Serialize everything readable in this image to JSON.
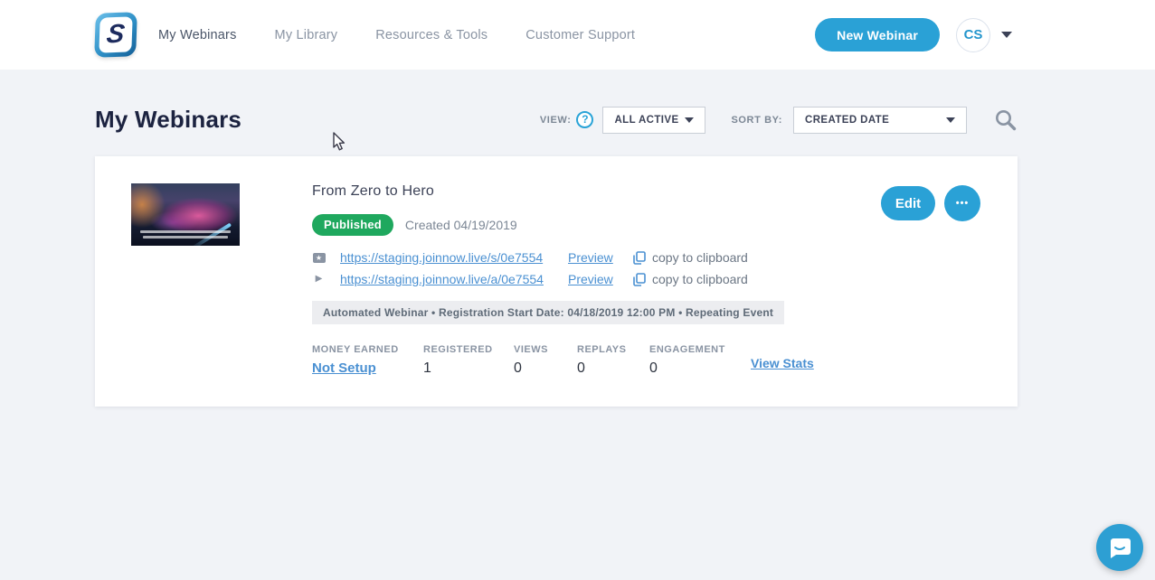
{
  "header": {
    "logo_text": "S",
    "nav": [
      {
        "label": "My Webinars"
      },
      {
        "label": "My Library"
      },
      {
        "label": "Resources & Tools"
      },
      {
        "label": "Customer Support"
      }
    ],
    "new_webinar_label": "New Webinar",
    "avatar_initials": "CS"
  },
  "toolbar": {
    "page_title": "My Webinars",
    "view_label": "VIEW:",
    "view_value": "ALL ACTIVE",
    "sort_label": "SORT BY:",
    "sort_value": "CREATED DATE"
  },
  "webinar": {
    "title": "From Zero to Hero",
    "status_badge": "Published",
    "created": "Created 04/19/2019",
    "links": [
      {
        "url": "https://staging.joinnow.live/s/0e7554",
        "preview_label": "Preview",
        "copy_label": "copy to clipboard"
      },
      {
        "url": "https://staging.joinnow.live/a/0e7554",
        "preview_label": "Preview",
        "copy_label": "copy to clipboard"
      }
    ],
    "info_bar": "Automated Webinar • Registration Start Date: 04/18/2019 12:00 PM • Repeating Event",
    "stats": [
      {
        "label": "MONEY EARNED",
        "value": "Not Setup"
      },
      {
        "label": "REGISTERED",
        "value": "1"
      },
      {
        "label": "VIEWS",
        "value": "0"
      },
      {
        "label": "REPLAYS",
        "value": "0"
      },
      {
        "label": "ENGAGEMENT",
        "value": "0"
      }
    ],
    "view_stats_label": "View Stats",
    "edit_label": "Edit",
    "more_label": "•••"
  },
  "icons": {
    "help_glyph": "?",
    "ticket_glyph": "★",
    "play_glyph": "▶"
  },
  "colors": {
    "accent_blue": "#2aa1d6",
    "link_blue": "#4a90d2",
    "published_green": "#1fa85e",
    "page_bg": "#f1f3f7"
  }
}
